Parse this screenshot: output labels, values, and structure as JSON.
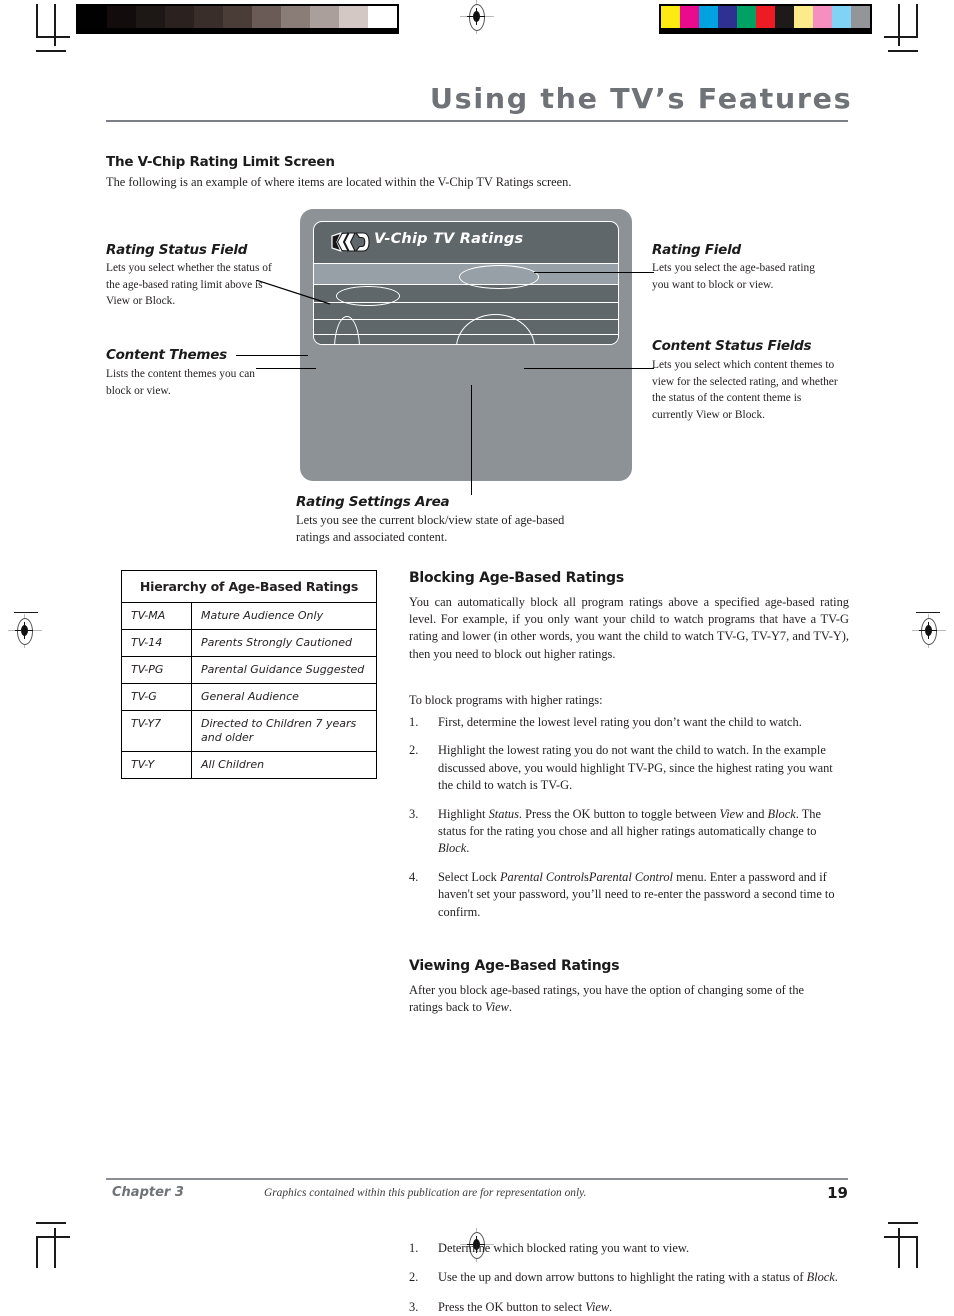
{
  "header": {
    "title": "Using the TV’s Features"
  },
  "intro": {
    "heading": "The V-Chip Rating Limit Screen",
    "text": "The following is an example of where items are located within the V-Chip TV Ratings screen."
  },
  "tv_screen": {
    "logo_icon": "vchip-swoosh-icon",
    "title": "V-Chip TV Ratings"
  },
  "callouts": {
    "rating_status_field": {
      "heading": "Rating Status Field",
      "text": "Lets you select whether the status of the age-based rating limit above is View or Block."
    },
    "content_themes": {
      "heading": "Content Themes",
      "text": "Lists the content themes you can block or view."
    },
    "rating_field": {
      "heading": "Rating Field",
      "text": "Lets you select the age-based rating you want to block or view."
    },
    "content_status_fields": {
      "heading": "Content Status Fields",
      "text": "Lets you select which content themes to view for the selected rating, and whether the status of the content theme is currently View or Block."
    },
    "rating_settings_area": {
      "heading": "Rating Settings Area",
      "text": "Lets you see the current block/view state of age-based ratings and associated content."
    }
  },
  "ratings_table": {
    "caption": "Hierarchy of Age-Based Ratings",
    "rows": [
      {
        "rating": "TV-MA",
        "description": "Mature Audience Only"
      },
      {
        "rating": "TV-14",
        "description": "Parents Strongly Cautioned"
      },
      {
        "rating": "TV-PG",
        "description": "Parental Guidance Suggested"
      },
      {
        "rating": "TV-G",
        "description": "General Audience"
      },
      {
        "rating": "TV-Y7",
        "description": "Directed to Children 7 years and older"
      },
      {
        "rating": "TV-Y",
        "description": "All Children"
      }
    ]
  },
  "blocking": {
    "heading": "Blocking Age-Based Ratings",
    "para1": "You can automatically block all program ratings above a specified age-based rating level. For example, if you only want your child to watch programs that have a TV-G rating and lower (in other words, you want the child to watch TV-G, TV-Y7, and TV-Y), then you need to block out higher ratings.",
    "para2": "To block programs with higher ratings:",
    "steps": [
      {
        "num": "1.",
        "text": "First, determine the lowest level rating you don’t want the child to watch."
      },
      {
        "num": "2.",
        "text": "Highlight the lowest rating you do not want the child to watch. In the example discussed above, you would highlight TV-PG, since the highest rating you want the child to watch is TV-G."
      },
      {
        "num": "3.",
        "text": "Highlight Status. Press the OK button to toggle between View and Block. The status for the rating you chose and all higher ratings automatically change to Block."
      },
      {
        "num": "4.",
        "text": "Select Lock Parental Controls from the Parental Control menu. Enter a password and if haven't set your password, you’ll need to re-enter the password a second time to confirm."
      }
    ]
  },
  "viewing": {
    "heading": "Viewing Age-Based Ratings",
    "para1": "After you block age-based ratings, you have the option of changing some of the ratings back to View.",
    "steps": [
      {
        "num": "1.",
        "text": "Determine which blocked rating you want to view."
      },
      {
        "num": "2.",
        "text": "Use the up and down arrow buttons to highlight the rating with a status of Block."
      },
      {
        "num": "3.",
        "text": "Press the OK button to select View."
      }
    ]
  },
  "footer": {
    "chapter": "Chapter 3",
    "note": "Graphics contained within this publication are for representation only.",
    "page": "19"
  },
  "print_marks": {
    "grayscale_bar": [
      "#010101",
      "#120d0c",
      "#1d1715",
      "#2b2220",
      "#3a2e2a",
      "#4a3c37",
      "#6a5b56",
      "#8a7d78",
      "#ab9f9b",
      "#d4c8c4",
      "#ffffff"
    ],
    "color_bar": [
      "#fdea10",
      "#ea0a8c",
      "#00a3e0",
      "#2e3192",
      "#00a263",
      "#ed1c24",
      "#1d1a1a",
      "#fbeb8b",
      "#f48fc0",
      "#81d3f5",
      "#939598"
    ]
  }
}
